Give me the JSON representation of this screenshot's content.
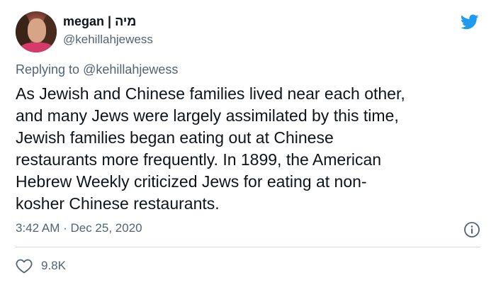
{
  "user": {
    "display_name": "megan | מיה",
    "handle": "@kehillahjewess",
    "avatar_icon": "avatar-photo"
  },
  "reply": {
    "prefix": "Replying to ",
    "mention": "@kehillahjewess"
  },
  "tweet": {
    "text": "As Jewish and Chinese families lived near each other,\nand many Jews were largely assimilated by this time,\nJewish families began eating out at Chinese\nrestaurants more frequently. In 1899, the American\nHebrew Weekly criticized Jews for eating at non-\nkosher Chinese restaurants.",
    "timestamp": "3:42 AM · Dec 25, 2020"
  },
  "stats": {
    "likes": "9.8K"
  },
  "colors": {
    "brand": "#1d9bf0",
    "secondary_text": "#536471",
    "primary_text": "#0f1419"
  },
  "icons": {
    "logo": "twitter-bird-icon",
    "info": "info-icon",
    "like": "heart-icon"
  }
}
